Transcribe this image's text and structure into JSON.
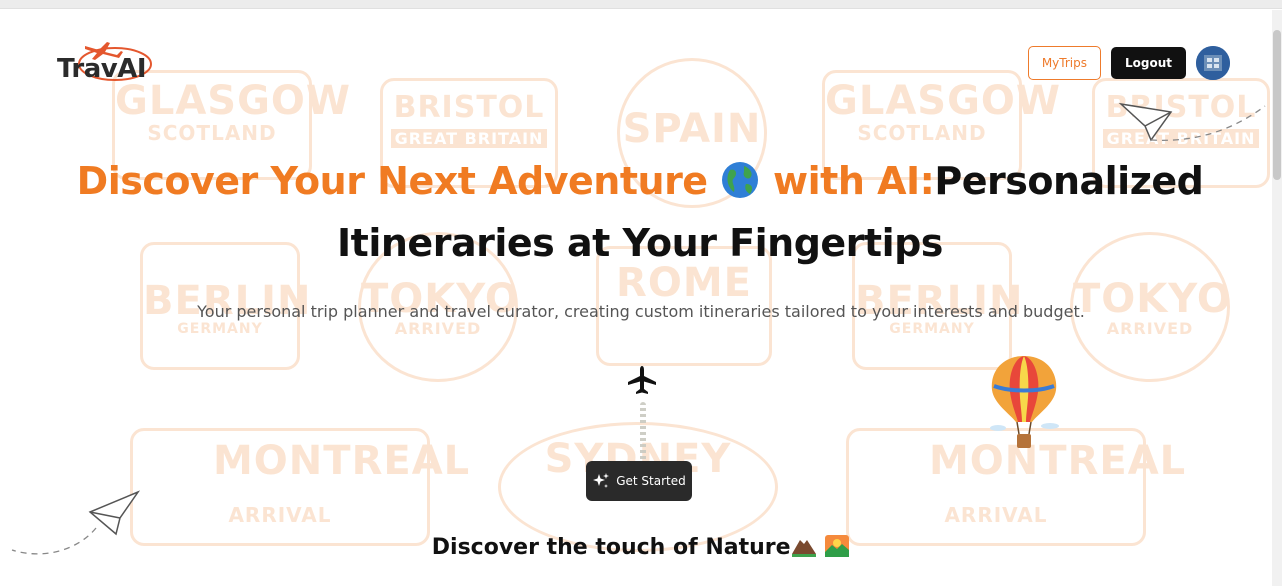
{
  "header": {
    "logo_text": "TravAI",
    "nav": {
      "my_trips_label": "MyTrips",
      "logout_label": "Logout"
    }
  },
  "hero": {
    "title_part1": "Discover Your Next Adventure",
    "title_part2": " with AI:",
    "title_part3": "Personalized Itineraries at Your Fingertips",
    "subtitle": "Your personal trip planner and travel curator, creating custom itineraries tailored to your interests and budget.",
    "cta_label": "Get Started"
  },
  "section": {
    "title": "Discover the touch of Nature"
  },
  "background_stamps": [
    {
      "city": "GLASGOW",
      "country": "SCOTLAND"
    },
    {
      "city": "BRISTOL",
      "country": "GREAT BRITAIN"
    },
    {
      "city": "SPAIN",
      "country": ""
    },
    {
      "city": "BERLIN",
      "country": "GERMANY"
    },
    {
      "city": "TOKYO",
      "country": "ARRIVED"
    },
    {
      "city": "ROME",
      "country": ""
    },
    {
      "city": "MONTREAL",
      "country": "ARRIVAL"
    },
    {
      "city": "SYDNEY",
      "country": ""
    }
  ],
  "colors": {
    "accent": "#f07b22",
    "dark": "#111111",
    "stamp": "#fbe4d2"
  }
}
